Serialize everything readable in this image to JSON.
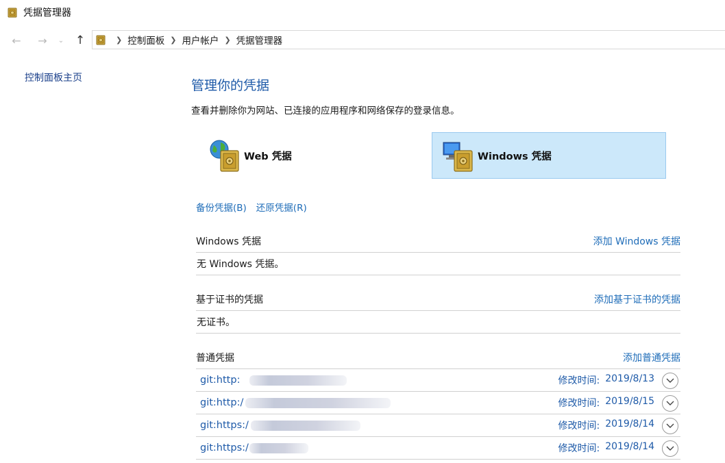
{
  "window": {
    "title": "凭据管理器",
    "app_icon": "vault-icon"
  },
  "nav": {
    "back_icon": "back-arrow-icon",
    "forward_icon": "forward-arrow-icon",
    "history_icon": "chevron-down-icon",
    "up_icon": "up-arrow-icon",
    "breadcrumb": [
      "控制面板",
      "用户帐户",
      "凭据管理器"
    ]
  },
  "sidebar": {
    "home_link": "控制面板主页"
  },
  "main": {
    "title": "管理你的凭据",
    "description": "查看并删除你为网站、已连接的应用程序和网络保存的登录信息。",
    "tiles": {
      "web_label": "Web 凭据",
      "windows_label": "Windows 凭据",
      "selected": "windows"
    },
    "backup_link": "备份凭据(B)",
    "restore_link": "还原凭据(R)"
  },
  "sections": {
    "windows": {
      "title": "Windows 凭据",
      "add_link": "添加 Windows 凭据",
      "empty_text": "无 Windows 凭据。"
    },
    "certificate": {
      "title": "基于证书的凭据",
      "add_link": "添加基于证书的凭据",
      "empty_text": "无证书。"
    },
    "generic": {
      "title": "普通凭据",
      "add_link": "添加普通凭据",
      "modified_label": "修改时间:",
      "items": [
        {
          "name": "git:http:",
          "modified": "2019/8/13"
        },
        {
          "name": "git:http:/",
          "modified": "2019/8/15"
        },
        {
          "name": "git:https:/",
          "modified": "2019/8/14"
        },
        {
          "name": "git:https:/",
          "modified": "2019/8/14"
        }
      ]
    }
  },
  "colors": {
    "link": "#1e6cb8",
    "title": "#1e5aa8",
    "selected_tile_bg": "#cce8fa"
  }
}
